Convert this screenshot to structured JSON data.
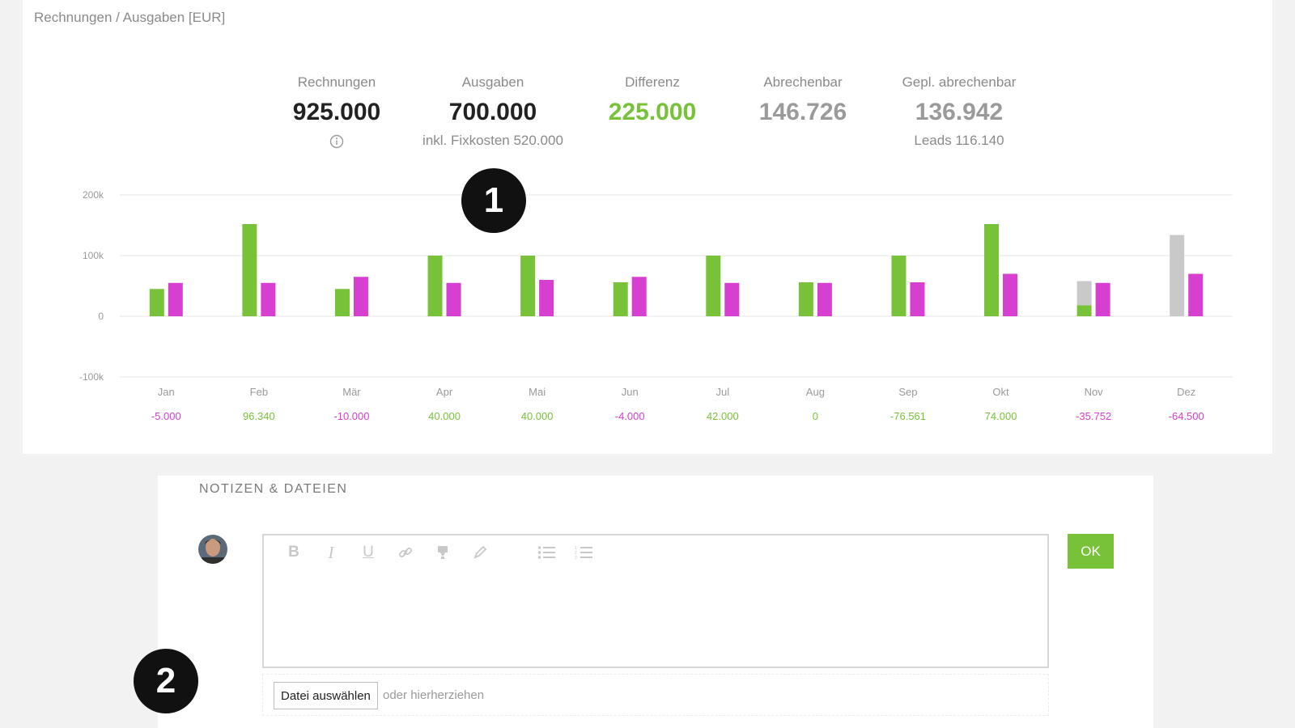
{
  "header": {
    "breadcrumb": "Rechnungen / Ausgaben [EUR]"
  },
  "kpis": [
    {
      "label": "Rechnungen",
      "value": "925.000",
      "sub": "",
      "color": "#222222",
      "info_icon": "info-circle-icon"
    },
    {
      "label": "Ausgaben",
      "value": "700.000",
      "sub": "inkl. Fixkosten 520.000",
      "color": "#222222"
    },
    {
      "label": "Differenz",
      "value": "225.000",
      "sub": "",
      "color": "#78c23a"
    },
    {
      "label": "Abrechenbar",
      "value": "146.726",
      "sub": "",
      "color": "#9a9a9a"
    },
    {
      "label": "Gepl. abrechenbar",
      "value": "136.942",
      "sub": "Leads 116.140",
      "color": "#9a9a9a"
    }
  ],
  "colors": {
    "invoices": "#78c23a",
    "expenses": "#d63fcf",
    "planned": "#c9c9c9",
    "positive": "#78c23a",
    "negative": "#d63fcf",
    "grid": "#e6e6e6",
    "axis_text": "#9a9a9a"
  },
  "chart_data": {
    "type": "bar",
    "categories": [
      "Jan",
      "Feb",
      "Mär",
      "Apr",
      "Mai",
      "Jun",
      "Jul",
      "Aug",
      "Sep",
      "Okt",
      "Nov",
      "Dez"
    ],
    "y_ticks": [
      "200k",
      "100k",
      "0",
      "-100k"
    ],
    "ylim": [
      -100000,
      200000
    ],
    "grid": true,
    "series": [
      {
        "values": [
          45000,
          152000,
          45000,
          100000,
          100000,
          56000,
          100000,
          56000,
          100000,
          152000,
          18000,
          0
        ],
        "planned": [
          0,
          0,
          0,
          0,
          0,
          0,
          0,
          0,
          0,
          0,
          40000,
          134000
        ]
      },
      {
        "values": [
          55000,
          55000,
          65000,
          55000,
          60000,
          65000,
          55000,
          55000,
          56000,
          70000,
          55000,
          70000
        ]
      }
    ],
    "differences": [
      "-5.000",
      "96.340",
      "-10.000",
      "40.000",
      "40.000",
      "-4.000",
      "42.000",
      "0",
      "-76.561",
      "74.000",
      "-35.752",
      "-64.500"
    ],
    "difference_signs": [
      "neg",
      "pos",
      "neg",
      "pos",
      "pos",
      "neg",
      "pos",
      "pos",
      "pos",
      "pos",
      "neg",
      "neg"
    ]
  },
  "notes": {
    "title": "NOTIZEN & DATEIEN",
    "toolbar": [
      "bold-icon",
      "italic-icon",
      "underline-icon",
      "link-icon",
      "highlight-icon",
      "pen-icon",
      "bullet-list-icon",
      "numbered-list-icon"
    ],
    "ok_label": "OK",
    "file_button": "Datei auswählen",
    "file_hint": "oder hierherziehen"
  },
  "callouts": [
    "1",
    "2"
  ]
}
